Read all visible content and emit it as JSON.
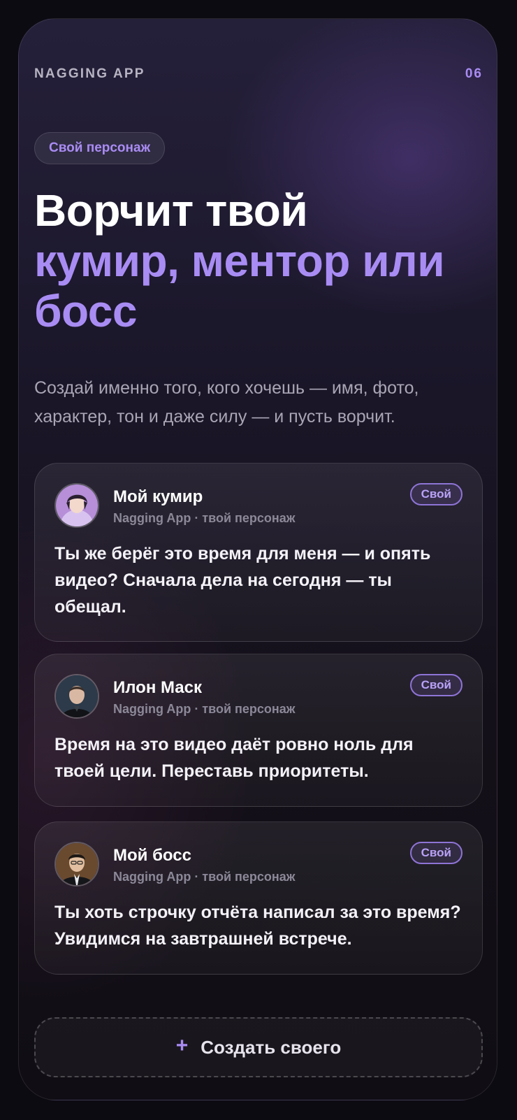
{
  "header": {
    "app_label": "NAGGING APP",
    "page_number": "06"
  },
  "tag": "Свой персонаж",
  "headline": {
    "line1": "Ворчит твой",
    "line2": "кумир, ментор или босс"
  },
  "subtitle": "Создай именно того, кого хочешь — имя, фото, характер, тон и даже силу — и пусть ворчит.",
  "cards": [
    {
      "name": "Мой кумир",
      "meta": "Nagging App · твой персонаж",
      "badge": "Свой",
      "message": "Ты же берёг это время для меня — и опять видео? Сначала дела на сегодня — ты обещал."
    },
    {
      "name": "Илон Маск",
      "meta": "Nagging App · твой персонаж",
      "badge": "Свой",
      "message": "Время на это видео даёт ровно ноль для твоей цели. Переставь приоритеты."
    },
    {
      "name": "Мой босс",
      "meta": "Nagging App · твой персонаж",
      "badge": "Свой",
      "message": "Ты хоть строчку отчёта написал за это время? Увидимся на завтрашней встрече."
    }
  ],
  "create_button": {
    "icon": "+",
    "label": "Создать своего"
  },
  "colors": {
    "accent": "#a98cf3",
    "background": "#141019",
    "text_primary": "#ffffff",
    "text_secondary": "#a9a5b5"
  }
}
